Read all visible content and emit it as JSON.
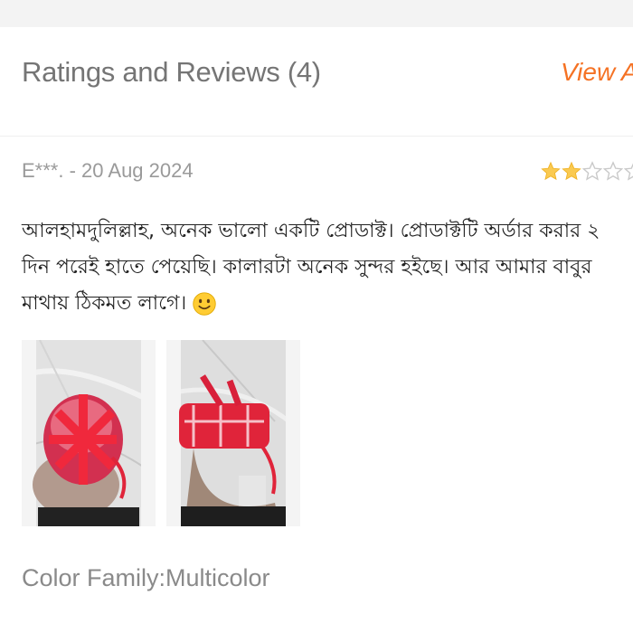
{
  "section": {
    "title": "Ratings and Reviews (4)",
    "view_all_label": "View All"
  },
  "review": {
    "author": "E***.",
    "date": "20 Aug 2024",
    "author_date": "E***. - 20 Aug 2024",
    "rating": 2,
    "max_rating": 5,
    "text_lines": [
      "আলহামদুলিল্লাহ, অনেক ভালো একটি প্রোডাক্ট। প্রোডাক্টটি অর্ডার করার ২",
      "দিন  পরেই হাতে পেয়েছি। কালারটা অনেক সুন্দর হইছে। আর আমার বাবুর",
      "মাথায় ঠিকমত লাগে।"
    ],
    "emoji": "slightly-smiling-face-icon",
    "images": [
      {
        "name": "review-photo-1"
      },
      {
        "name": "review-photo-2"
      }
    ],
    "sku_info": "Color Family:Multicolor"
  },
  "colors": {
    "accent": "#f57224",
    "star_filled": "#faca51",
    "star_empty": "#c9c9c9",
    "product_red": "#e0243a"
  }
}
